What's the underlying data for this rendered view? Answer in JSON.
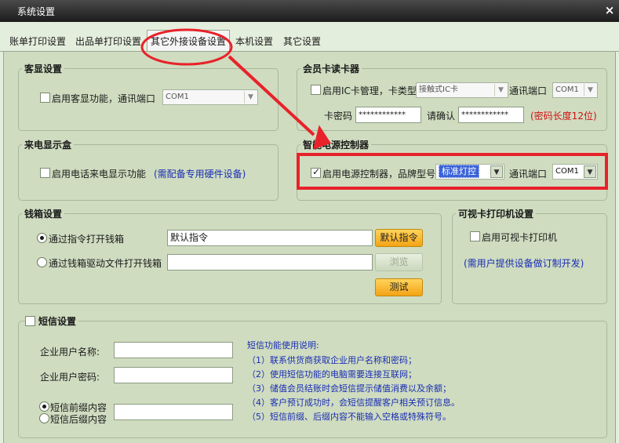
{
  "window": {
    "title": "系统设置",
    "close": "×"
  },
  "tabs": [
    "账单打印设置",
    "出品单打印设置",
    "其它外接设备设置",
    "本机设置",
    "其它设置"
  ],
  "customer_display": {
    "title": "客显设置",
    "enable_label": "启用客显功能，通讯端口",
    "port": "COM1"
  },
  "member_card": {
    "title": "会员卡读卡器",
    "enable_label": "启用IC卡管理，卡类型",
    "card_type": "接触式IC卡",
    "port_label": "通讯端口",
    "port": "COM1",
    "password_label": "卡密码",
    "password": "************",
    "confirm_label": "请确认",
    "confirm": "************",
    "length_note": "(密码长度12位)"
  },
  "caller_id": {
    "title": "来电显示盒",
    "enable_label": "启用电话来电显示功能",
    "note": "(需配备专用硬件设备)"
  },
  "power_controller": {
    "title": "智能电源控制器",
    "enable_label": "启用电源控制器，品牌型号",
    "brand": "标准灯控",
    "port_label": "通讯端口",
    "port": "COM1"
  },
  "cash_drawer": {
    "title": "钱箱设置",
    "option1_label": "通过指令打开钱箱",
    "command_value": "默认指令",
    "default_button": "默认指令",
    "option2_label": "通过钱箱驱动文件打开钱箱",
    "browse_button": "浏览",
    "test_button": "测试"
  },
  "visible_card_printer": {
    "title": "可视卡打印机设置",
    "enable_label": "启用可视卡打印机",
    "note": "(需用户提供设备做订制开发)"
  },
  "sms": {
    "title": "短信设置",
    "username_label": "企业用户名称:",
    "password_label": "企业用户密码:",
    "prefix_label": "短信前缀内容",
    "suffix_label": "短信后缀内容",
    "help_title": "短信功能使用说明:",
    "help_lines": [
      "（1）联系供货商获取企业用户名称和密码；",
      "（2）使用短信功能的电脑需要连接互联网；",
      "（3）储值会员结账时会短信提示储值消费以及余额；",
      "（4）客户预订成功时，会短信提醒客户相关预订信息。",
      "（5）短信前缀、后缀内容不能输入空格或特殊符号。"
    ]
  },
  "colors": {
    "accent_red": "#e8222a",
    "link_blue": "#1a2db4",
    "button_orange": "#f4a315"
  }
}
